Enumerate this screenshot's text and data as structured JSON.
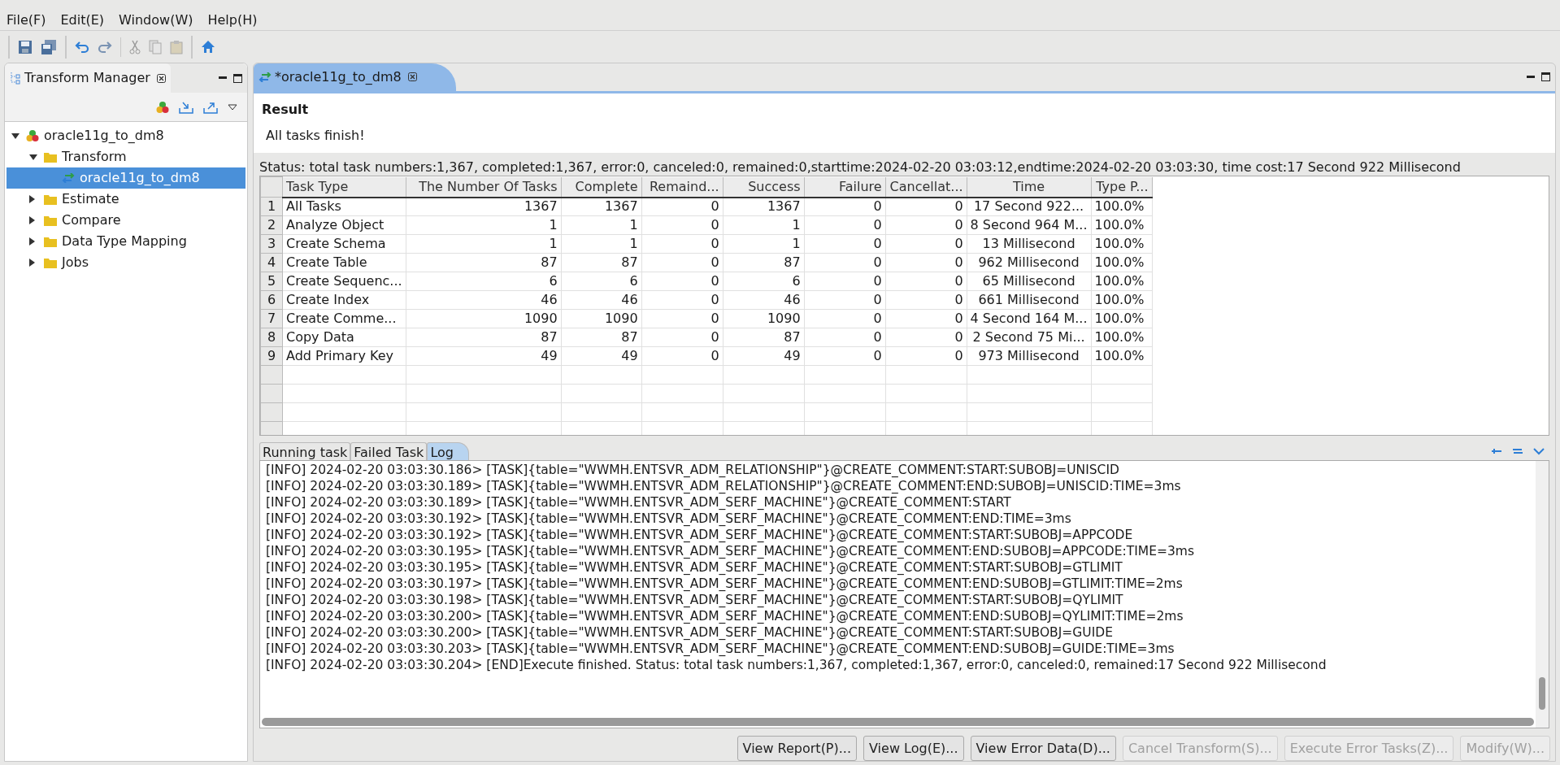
{
  "menu": [
    "File(F)",
    "Edit(E)",
    "Window(W)",
    "Help(H)"
  ],
  "left_panel": {
    "title": "Transform Manager",
    "tree": [
      {
        "label": "oracle11g_to_dm8",
        "kind": "project",
        "expanded": true,
        "selected": false,
        "children": [
          {
            "label": "Transform",
            "kind": "folder",
            "expanded": true,
            "selected": false,
            "children": [
              {
                "label": "oracle11g_to_dm8",
                "kind": "transform",
                "selected": true
              }
            ]
          },
          {
            "label": "Estimate",
            "kind": "folder",
            "expanded": false,
            "selected": false
          },
          {
            "label": "Compare",
            "kind": "folder",
            "expanded": false,
            "selected": false
          },
          {
            "label": "Data Type Mapping",
            "kind": "folder",
            "expanded": false,
            "selected": false
          },
          {
            "label": "Jobs",
            "kind": "folder",
            "expanded": false,
            "selected": false
          }
        ]
      }
    ]
  },
  "editor": {
    "tab": "*oracle11g_to_dm8",
    "result_title": "Result",
    "result_text": "All tasks finish!",
    "status": "Status: total task numbers:1,367, completed:1,367, error:0, canceled:0, remained:0,starttime:2024-02-20 03:03:12,endtime:2024-02-20 03:03:30, time cost:17 Second 922 Millisecond",
    "table": {
      "columns": [
        "",
        "Task Type",
        "The Number Of Tasks",
        "Complete",
        "Remaind...",
        "Success",
        "Failure",
        "Cancellat...",
        "Time",
        "Type P..."
      ],
      "rows": [
        [
          "1",
          "All Tasks",
          "1367",
          "1367",
          "0",
          "1367",
          "0",
          "0",
          "17 Second 922...",
          "100.0%"
        ],
        [
          "2",
          "Analyze Object",
          "1",
          "1",
          "0",
          "1",
          "0",
          "0",
          "8 Second 964 M...",
          "100.0%"
        ],
        [
          "3",
          "Create Schema",
          "1",
          "1",
          "0",
          "1",
          "0",
          "0",
          "13 Millisecond",
          "100.0%"
        ],
        [
          "4",
          "Create Table",
          "87",
          "87",
          "0",
          "87",
          "0",
          "0",
          "962 Millisecond",
          "100.0%"
        ],
        [
          "5",
          "Create Sequenc...",
          "6",
          "6",
          "0",
          "6",
          "0",
          "0",
          "65 Millisecond",
          "100.0%"
        ],
        [
          "6",
          "Create Index",
          "46",
          "46",
          "0",
          "46",
          "0",
          "0",
          "661 Millisecond",
          "100.0%"
        ],
        [
          "7",
          "Create Comme...",
          "1090",
          "1090",
          "0",
          "1090",
          "0",
          "0",
          "4 Second 164 M...",
          "100.0%"
        ],
        [
          "8",
          "Copy Data",
          "87",
          "87",
          "0",
          "87",
          "0",
          "0",
          "2 Second 75 Mi...",
          "100.0%"
        ],
        [
          "9",
          "Add Primary Key",
          "49",
          "49",
          "0",
          "49",
          "0",
          "0",
          "973 Millisecond",
          "100.0%"
        ]
      ]
    },
    "bottom_tabs": [
      {
        "label": "Running task",
        "selected": false
      },
      {
        "label": "Failed Task",
        "selected": false
      },
      {
        "label": "Log",
        "selected": true
      }
    ],
    "log": [
      "[INFO] 2024-02-20 03:03:30.186> [TASK]{table=\"WWMH.ENTSVR_ADM_RELATIONSHIP\"}@CREATE_COMMENT:START:SUBOBJ=UNISCID",
      "[INFO] 2024-02-20 03:03:30.189> [TASK]{table=\"WWMH.ENTSVR_ADM_RELATIONSHIP\"}@CREATE_COMMENT:END:SUBOBJ=UNISCID:TIME=3ms",
      "[INFO] 2024-02-20 03:03:30.189> [TASK]{table=\"WWMH.ENTSVR_ADM_SERF_MACHINE\"}@CREATE_COMMENT:START",
      "[INFO] 2024-02-20 03:03:30.192> [TASK]{table=\"WWMH.ENTSVR_ADM_SERF_MACHINE\"}@CREATE_COMMENT:END:TIME=3ms",
      "[INFO] 2024-02-20 03:03:30.192> [TASK]{table=\"WWMH.ENTSVR_ADM_SERF_MACHINE\"}@CREATE_COMMENT:START:SUBOBJ=APPCODE",
      "[INFO] 2024-02-20 03:03:30.195> [TASK]{table=\"WWMH.ENTSVR_ADM_SERF_MACHINE\"}@CREATE_COMMENT:END:SUBOBJ=APPCODE:TIME=3ms",
      "[INFO] 2024-02-20 03:03:30.195> [TASK]{table=\"WWMH.ENTSVR_ADM_SERF_MACHINE\"}@CREATE_COMMENT:START:SUBOBJ=GTLIMIT",
      "[INFO] 2024-02-20 03:03:30.197> [TASK]{table=\"WWMH.ENTSVR_ADM_SERF_MACHINE\"}@CREATE_COMMENT:END:SUBOBJ=GTLIMIT:TIME=2ms",
      "[INFO] 2024-02-20 03:03:30.198> [TASK]{table=\"WWMH.ENTSVR_ADM_SERF_MACHINE\"}@CREATE_COMMENT:START:SUBOBJ=QYLIMIT",
      "[INFO] 2024-02-20 03:03:30.200> [TASK]{table=\"WWMH.ENTSVR_ADM_SERF_MACHINE\"}@CREATE_COMMENT:END:SUBOBJ=QYLIMIT:TIME=2ms",
      "[INFO] 2024-02-20 03:03:30.200> [TASK]{table=\"WWMH.ENTSVR_ADM_SERF_MACHINE\"}@CREATE_COMMENT:START:SUBOBJ=GUIDE",
      "[INFO] 2024-02-20 03:03:30.203> [TASK]{table=\"WWMH.ENTSVR_ADM_SERF_MACHINE\"}@CREATE_COMMENT:END:SUBOBJ=GUIDE:TIME=3ms",
      "[INFO] 2024-02-20 03:03:30.204> [END]Execute finished. Status: total task numbers:1,367, completed:1,367, error:0, canceled:0, remained:17 Second 922 Millisecond"
    ],
    "buttons": [
      {
        "label": "View Report(P)...",
        "disabled": false
      },
      {
        "label": "View Log(E)...",
        "disabled": false
      },
      {
        "label": "View Error Data(D)...",
        "disabled": false
      },
      {
        "label": "Cancel Transform(S)...",
        "disabled": true
      },
      {
        "label": "Execute Error Tasks(Z)...",
        "disabled": true
      },
      {
        "label": "Modify(W)...",
        "disabled": true
      }
    ]
  }
}
